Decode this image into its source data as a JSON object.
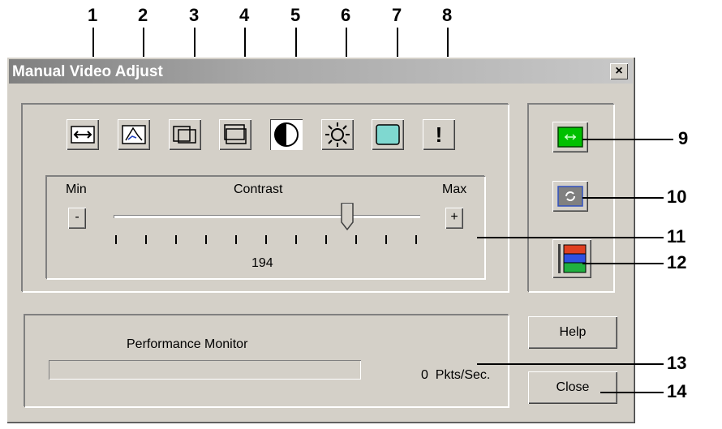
{
  "callouts": [
    "1",
    "2",
    "3",
    "4",
    "5",
    "6",
    "7",
    "8",
    "9",
    "10",
    "11",
    "12",
    "13",
    "14"
  ],
  "window": {
    "title": "Manual Video Adjust",
    "close_glyph": "×"
  },
  "toolbar": {
    "buttons": [
      {
        "icon": "horizontal-size-icon"
      },
      {
        "icon": "pixel-sampling-icon"
      },
      {
        "icon": "horizontal-position-icon"
      },
      {
        "icon": "vertical-position-icon"
      },
      {
        "icon": "contrast-icon",
        "selected": true
      },
      {
        "icon": "brightness-icon"
      },
      {
        "icon": "color-noise-icon"
      },
      {
        "icon": "exclamation-icon",
        "glyph": "!"
      }
    ]
  },
  "slider": {
    "min_label": "Min",
    "max_label": "Max",
    "title": "Contrast",
    "decrease_label": "-",
    "increase_label": "+",
    "value": "194"
  },
  "side": {
    "buttons": [
      {
        "icon": "auto-adjust-icon"
      },
      {
        "icon": "refresh-screen-icon"
      },
      {
        "icon": "color-adjust-icon"
      }
    ]
  },
  "performance": {
    "label": "Performance Monitor",
    "rate": "0  Pkts/Sec."
  },
  "buttons": {
    "help": "Help",
    "close": "Close"
  },
  "colors": {
    "auto_adjust_green": "#00c000",
    "color_noise_cyan": "#7fd8d0",
    "color_red": "#e04020",
    "color_blue": "#3050e0",
    "color_green": "#20b040"
  }
}
